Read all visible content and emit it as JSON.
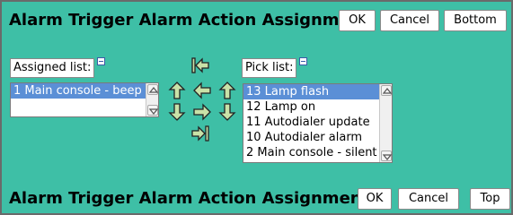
{
  "title": "Alarm Trigger Alarm Action Assignment",
  "top_buttons": {
    "ok": "OK",
    "cancel": "Cancel",
    "bottom": "Bottom"
  },
  "bottom_buttons": {
    "ok": "OK",
    "cancel": "Cancel",
    "top": "Top"
  },
  "assigned": {
    "label": "Assigned list:",
    "items": [
      "1 Main console - beep"
    ]
  },
  "pick": {
    "label": "Pick list:",
    "items": [
      "13 Lamp flash",
      "12 Lamp on",
      "11 Autodialer update",
      "10 Autodialer alarm",
      "2 Main console - silent"
    ]
  },
  "colors": {
    "background": "#3ebfa6",
    "selected": "#5b8fd6",
    "arrow_fill": "#c9e2a8"
  }
}
